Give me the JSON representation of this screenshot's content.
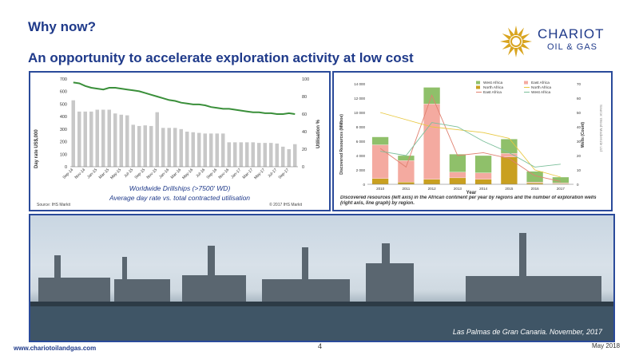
{
  "slide": {
    "title": "Why now?",
    "subtitle": "An opportunity to accelerate exploration activity at low cost",
    "footer_url": "www.chariotoilandgas.com",
    "page_number": "4",
    "date": "May 2018"
  },
  "logo": {
    "name": "CHARIOT",
    "sub": "OIL & GAS",
    "icon": "sun-star-icon",
    "accent": "#d9a520"
  },
  "photo": {
    "caption": "Las Palmas de Gran Canaria. November, 2017"
  },
  "chart_data": [
    {
      "type": "bar",
      "title": "Worldwide Drillships (>7500' WD)",
      "subtitle": "Average day rate vs. total contracted utilisation",
      "ylabel": "Day rate US$,000",
      "y2label": "Utilisation %",
      "source": "Source: IHS Markit",
      "copyright": "© 2017 IHS Markit",
      "ylim": [
        0,
        700
      ],
      "y2lim": [
        0,
        100
      ],
      "yticks": [
        "0",
        "100",
        "200",
        "300",
        "400",
        "500",
        "600",
        "700"
      ],
      "y2ticks": [
        "0",
        "20",
        "40",
        "60",
        "80",
        "100"
      ],
      "xticks": [
        "Sep-14",
        "Nov-14",
        "Jan-15",
        "Mar-15",
        "May-15",
        "Jul-15",
        "Sep-15",
        "Nov-15",
        "Jan-16",
        "Mar-16",
        "May-16",
        "Jul-16",
        "Sep-16",
        "Nov-16",
        "Jan-17",
        "Mar-17",
        "May-17",
        "Jul-17",
        "Sep-17"
      ],
      "bar_values": [
        530,
        440,
        440,
        440,
        455,
        455,
        455,
        425,
        415,
        410,
        335,
        325,
        330,
        325,
        435,
        310,
        310,
        310,
        300,
        280,
        275,
        270,
        265,
        265,
        265,
        265,
        195,
        195,
        195,
        195,
        195,
        190,
        190,
        190,
        185,
        160,
        140,
        180
      ],
      "line_values": [
        96,
        95,
        92,
        90,
        89,
        88,
        90,
        90,
        89,
        88,
        87,
        86,
        84,
        82,
        80,
        78,
        76,
        75,
        73,
        72,
        71,
        71,
        70,
        68,
        67,
        66,
        66,
        65,
        64,
        63,
        62,
        62,
        61,
        61,
        60,
        60,
        61,
        60
      ],
      "bar_color": "#c8c8c8",
      "line_color": "#3a8f3a",
      "grid": false
    },
    {
      "type": "bar",
      "stacked": true,
      "xlabel": "Year",
      "ylabel": "Discovered Resources (MMboe)",
      "y2label": "Wells (Count)",
      "source_note": "Source: Wood Mackenzie Ltd",
      "caption": "Discovered resources (left axis) in the African continent per year by regions and the number of exploration wells (right axis, line graph) by region.",
      "categories": [
        "2010",
        "2011",
        "2012",
        "2013",
        "2014",
        "2015",
        "2016",
        "2017"
      ],
      "ylim": [
        0,
        14000
      ],
      "y2lim": [
        0,
        70
      ],
      "yticks": [
        "0",
        "2 000",
        "4 000",
        "6 000",
        "8 000",
        "10 000",
        "12 000",
        "14 000"
      ],
      "y2ticks": [
        "0",
        "10",
        "20",
        "30",
        "40",
        "50",
        "60",
        "70"
      ],
      "series": [
        {
          "name": "North Africa",
          "color": "#c9a020",
          "values": [
            800,
            300,
            700,
            900,
            700,
            3800,
            200,
            100
          ]
        },
        {
          "name": "East Africa",
          "color": "#f4aaa0",
          "values": [
            4700,
            3000,
            10500,
            800,
            900,
            500,
            100,
            100
          ]
        },
        {
          "name": "West Africa",
          "color": "#8fc06a",
          "values": [
            1100,
            700,
            2300,
            2500,
            2400,
            2000,
            1500,
            800
          ]
        }
      ],
      "wells": [
        {
          "name": "East Africa",
          "color": "#e08070",
          "values": [
            25,
            12,
            62,
            20,
            22,
            18,
            6,
            2
          ]
        },
        {
          "name": "North Africa",
          "color": "#e8c840",
          "values": [
            50,
            45,
            40,
            38,
            36,
            32,
            10,
            5
          ]
        },
        {
          "name": "West Africa",
          "color": "#7bbf9a",
          "values": [
            23,
            20,
            43,
            40,
            30,
            22,
            12,
            14
          ]
        }
      ],
      "grid": false,
      "legend": "top-center"
    }
  ]
}
